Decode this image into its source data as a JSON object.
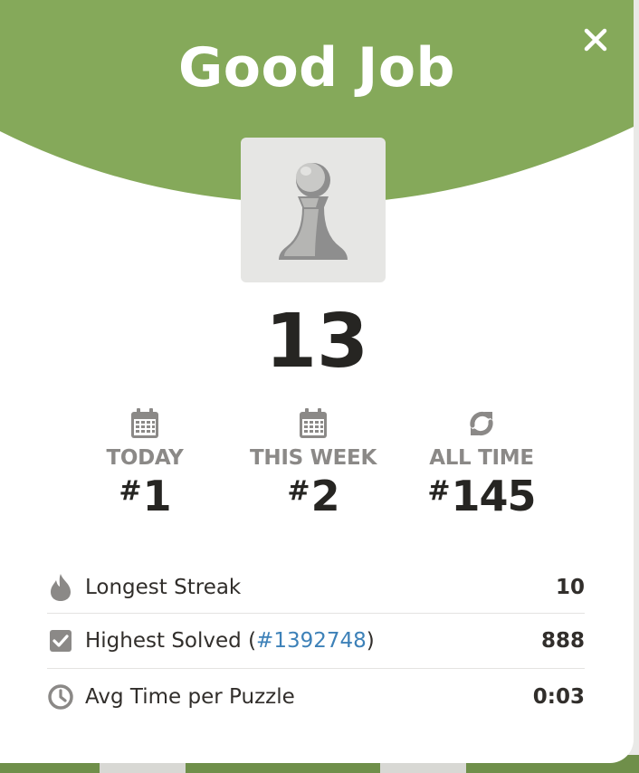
{
  "modal": {
    "title": "Good Job",
    "close_icon": "close-icon",
    "score": "13",
    "piece_icon": "pawn-icon"
  },
  "ranks": [
    {
      "label": "TODAY",
      "hash": "#",
      "value": "1",
      "icon": "calendar-icon"
    },
    {
      "label": "THIS WEEK",
      "hash": "#",
      "value": "2",
      "icon": "calendar-icon"
    },
    {
      "label": "ALL TIME",
      "hash": "#",
      "value": "145",
      "icon": "refresh-icon"
    }
  ],
  "stats": {
    "longest_streak": {
      "label": "Longest Streak",
      "value": "10",
      "icon": "flame-icon"
    },
    "highest_solved": {
      "label": "Highest Solved",
      "paren_open": "(",
      "link": "#1392748",
      "paren_close": ")",
      "value": "888",
      "icon": "checkbox-icon"
    },
    "avg_time": {
      "label": "Avg Time per Puzzle",
      "value": "0:03",
      "icon": "clock-icon"
    }
  },
  "colors": {
    "header_green": "#85a95a",
    "text_dark": "#262522",
    "label_gray": "#8b8987",
    "link_blue": "#3d81b8",
    "icon_gray": "#8b8987"
  }
}
